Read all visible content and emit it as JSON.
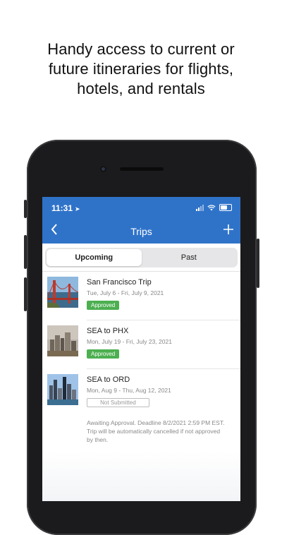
{
  "headline": [
    "Handy access to current or",
    "future itineraries for flights,",
    "hotels, and rentals"
  ],
  "status": {
    "time": "11:31"
  },
  "nav": {
    "title": "Trips"
  },
  "tabs": [
    {
      "label": "Upcoming",
      "active": true
    },
    {
      "label": "Past",
      "active": false
    }
  ],
  "trips": [
    {
      "name": "San Francisco Trip",
      "dates": "Tue, July 6 - Fri, July 9, 2021",
      "status": "Approved"
    },
    {
      "name": "SEA to PHX",
      "dates": "Mon, July 19 - Fri, July 23, 2021",
      "status": "Approved"
    },
    {
      "name": "SEA to ORD",
      "dates": "Mon, Aug 9 - Thu, Aug 12,  2021",
      "status": "Not Submitted",
      "note": "Awaiting Approval. Deadline 8/2/2021 2:59 PM EST. Trip will be automatically cancelled if not approved by then."
    }
  ],
  "colors": {
    "brand_blue": "#2f73c9",
    "approved_green": "#4caf50"
  }
}
